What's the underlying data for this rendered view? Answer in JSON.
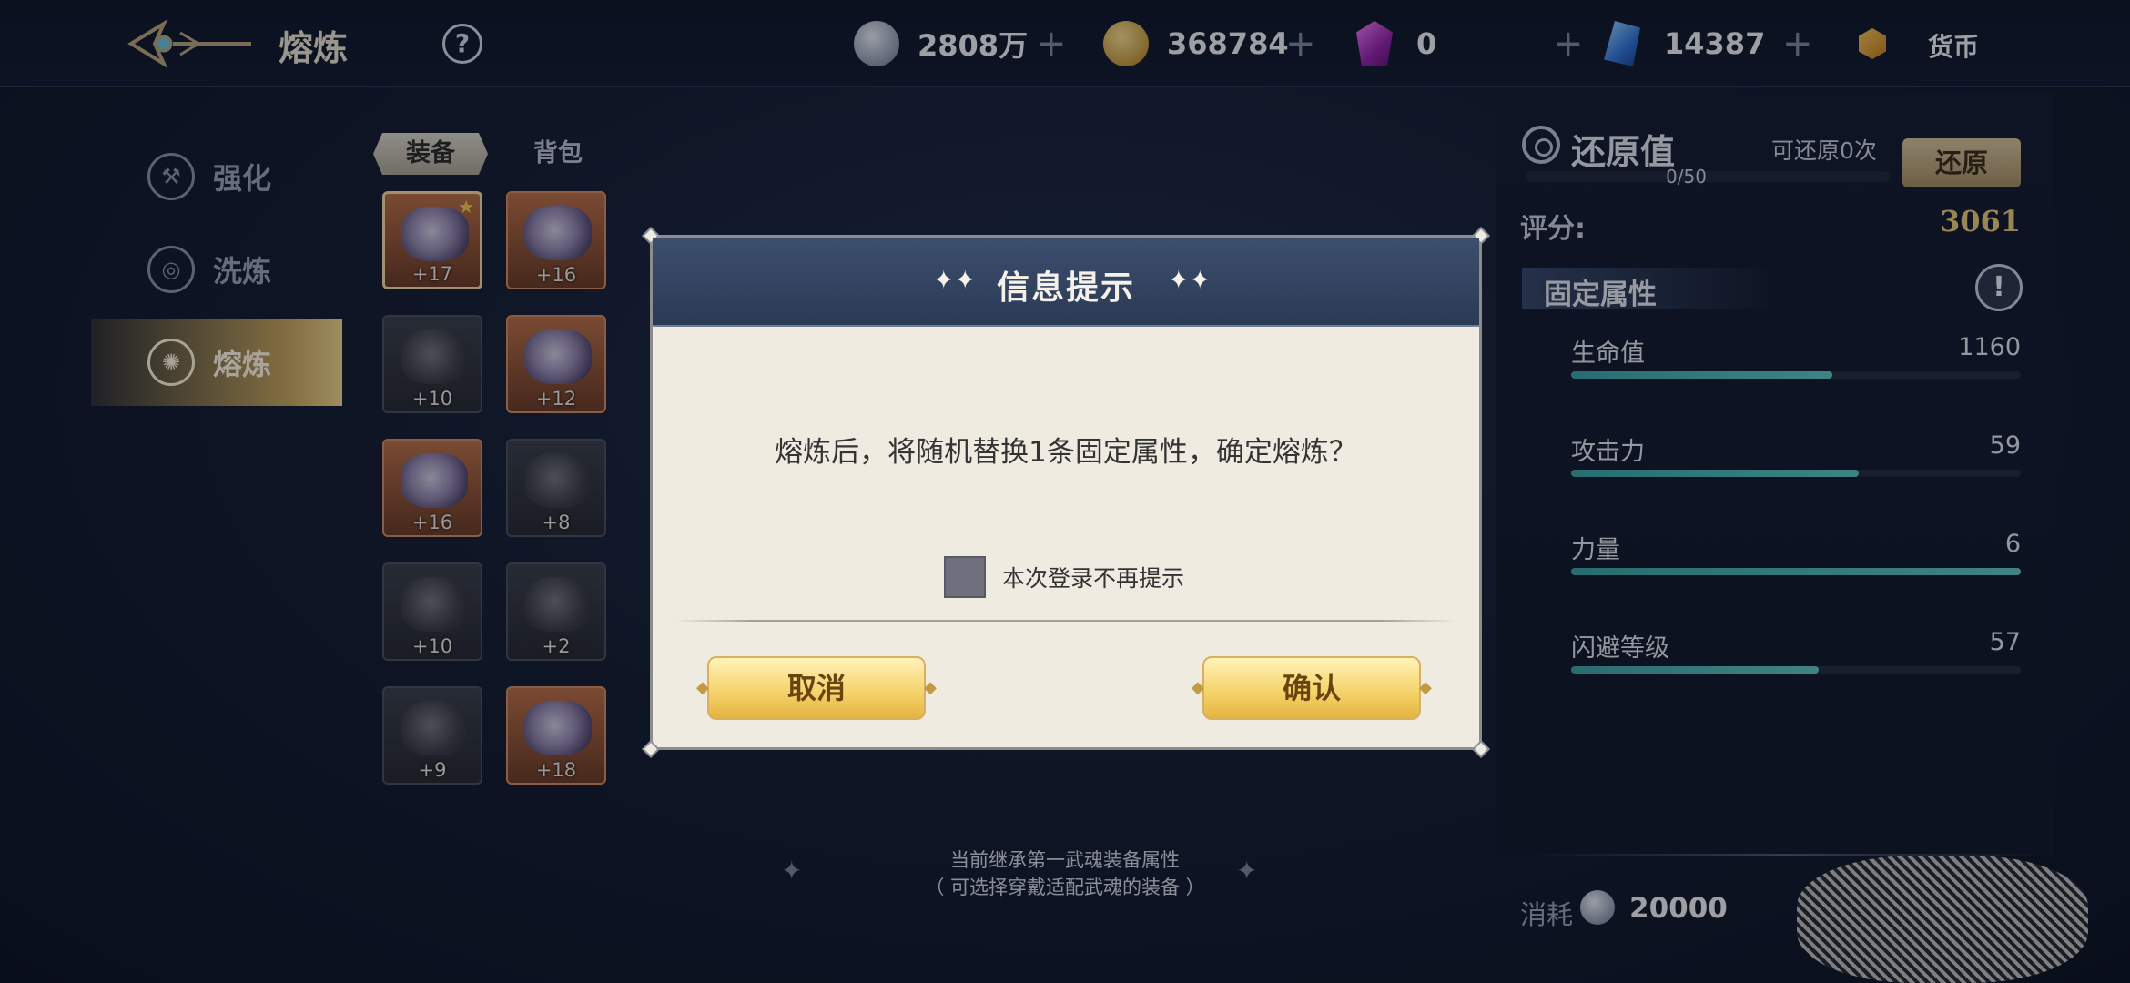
{
  "header": {
    "title": "熔炼",
    "help_glyph": "?",
    "currencies": [
      {
        "icon": "silver-coin-icon",
        "value": "2808万",
        "plus": "+"
      },
      {
        "icon": "gold-coin-icon",
        "value": "368784",
        "plus": "+"
      },
      {
        "icon": "purple-gem-icon",
        "value": "0",
        "plus": "+"
      },
      {
        "icon": "blue-crystal-icon",
        "value": "14387",
        "plus": "+"
      }
    ],
    "currency_label": "货币"
  },
  "nav": {
    "items": [
      {
        "label": "强化",
        "icon": "enhance-icon"
      },
      {
        "label": "洗炼",
        "icon": "refine-icon"
      },
      {
        "label": "熔炼",
        "icon": "smelt-icon",
        "active": true
      }
    ]
  },
  "tabs": [
    "装备",
    "背包"
  ],
  "equipment": [
    {
      "level": "+17",
      "rarity": "orange",
      "star": "★",
      "selected": true
    },
    {
      "level": "+16",
      "rarity": "orange"
    },
    {
      "level": "+10",
      "rarity": "grey"
    },
    {
      "level": "+12",
      "rarity": "orange"
    },
    {
      "level": "+16",
      "rarity": "orange"
    },
    {
      "level": "+8",
      "rarity": "grey"
    },
    {
      "level": "+10",
      "rarity": "grey"
    },
    {
      "level": "+2",
      "rarity": "grey"
    },
    {
      "level": "+9",
      "rarity": "grey"
    },
    {
      "level": "+18",
      "rarity": "orange"
    }
  ],
  "inherit_note": {
    "line1": "当前继承第一武魂装备属性",
    "line2": "（ 可选择穿戴适配武魂的装备 ）"
  },
  "right_panel": {
    "restore_title": "还原值",
    "restore_count": "可还原0次",
    "restore_button": "还原",
    "restore_progress": "0/50",
    "score_label": "评分:",
    "score_value": "3061",
    "fixed_title": "固定属性",
    "warn_glyph": "!",
    "attributes": [
      {
        "name": "生命值",
        "value": "1160",
        "fill": 0.58
      },
      {
        "name": "攻击力",
        "value": "59",
        "fill": 0.64
      },
      {
        "name": "力量",
        "value": "6",
        "fill": 1.0
      },
      {
        "name": "闪避等级",
        "value": "57",
        "fill": 0.55
      }
    ],
    "cost_label": "消耗",
    "cost_value": "20000"
  },
  "dialog": {
    "title": "信息提示",
    "title_sparkle": "✦✦",
    "message": "熔炼后，将随机替换1条固定属性，确定熔炼？",
    "dont_remind": "本次登录不再提示",
    "cancel": "取消",
    "confirm": "确认"
  }
}
